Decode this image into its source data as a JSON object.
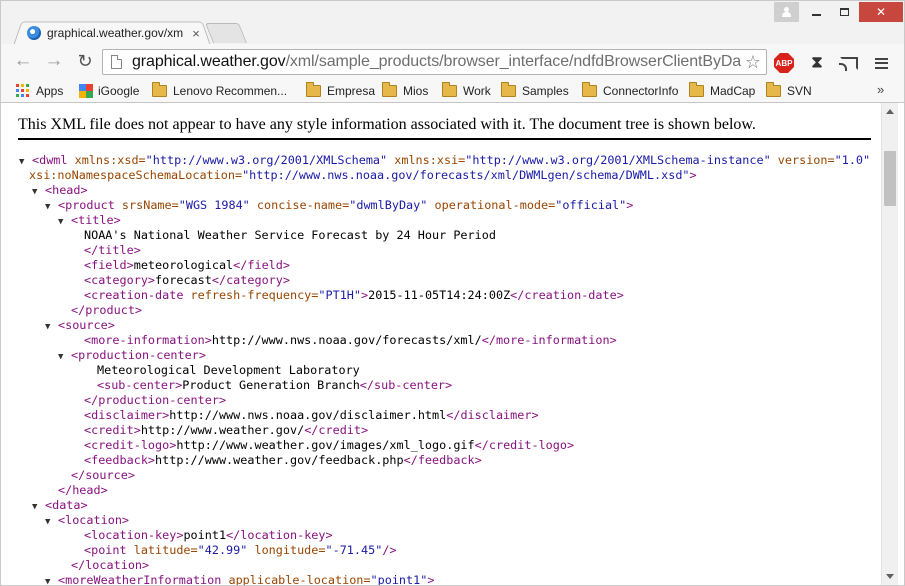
{
  "tab": {
    "title": "graphical.weather.gov/xm",
    "close": "×"
  },
  "window": {
    "minimize": "",
    "maximize": "",
    "close": "✕"
  },
  "nav": {
    "back": "←",
    "forward": "→",
    "reload": "↻",
    "star": "☆",
    "abp": "ABP"
  },
  "omnibox": {
    "host": "graphical.weather.gov",
    "path": "/xml/sample_products/browser_interface/ndfdBrowserClientByDa"
  },
  "bookmarks": {
    "items": [
      {
        "label": "Apps",
        "icon": "apps-icon"
      },
      {
        "label": "iGoogle",
        "icon": "igoogle-icon"
      },
      {
        "label": "Lenovo Recommen...",
        "icon": "folder-icon"
      },
      {
        "label": "Empresa",
        "icon": "folder-icon"
      },
      {
        "label": "Mios",
        "icon": "folder-icon"
      },
      {
        "label": "Work",
        "icon": "folder-icon"
      },
      {
        "label": "Samples",
        "icon": "folder-icon"
      },
      {
        "label": "ConnectorInfo",
        "icon": "folder-icon"
      },
      {
        "label": "MadCap",
        "icon": "folder-icon"
      },
      {
        "label": "SVN",
        "icon": "folder-icon"
      }
    ],
    "more": "»"
  },
  "page": {
    "info": "This XML file does not appear to have any style information associated with it. The document tree is shown below."
  },
  "xml_lines": [
    {
      "indent": 0,
      "tri": "▼",
      "parts": [
        [
          "t",
          "<dwml "
        ],
        [
          "n",
          "xmlns:xsd="
        ],
        [
          "v",
          "\"http://www.w3.org/2001/XMLSchema\""
        ],
        [
          "x",
          " "
        ],
        [
          "n",
          "xmlns:xsi="
        ],
        [
          "v",
          "\"http://www.w3.org/2001/XMLSchema-instance\""
        ],
        [
          "x",
          " "
        ],
        [
          "n",
          "version="
        ],
        [
          "v",
          "\"1.0\""
        ]
      ]
    },
    {
      "indent": 0,
      "tri": "",
      "parts": [
        [
          "n",
          "xsi:noNamespaceSchemaLocation="
        ],
        [
          "v",
          "\"http://www.nws.noaa.gov/forecasts/xml/DWMLgen/schema/DWML.xsd\""
        ],
        [
          "t",
          ">"
        ]
      ]
    },
    {
      "indent": 1,
      "tri": "▼",
      "parts": [
        [
          "t",
          "<head>"
        ]
      ]
    },
    {
      "indent": 2,
      "tri": "▼",
      "parts": [
        [
          "t",
          "<product "
        ],
        [
          "n",
          "srsName="
        ],
        [
          "v",
          "\"WGS 1984\""
        ],
        [
          "x",
          " "
        ],
        [
          "n",
          "concise-name="
        ],
        [
          "v",
          "\"dwmlByDay\""
        ],
        [
          "x",
          " "
        ],
        [
          "n",
          "operational-mode="
        ],
        [
          "v",
          "\"official\""
        ],
        [
          "t",
          ">"
        ]
      ]
    },
    {
      "indent": 3,
      "tri": "▼",
      "parts": [
        [
          "t",
          "<title>"
        ]
      ]
    },
    {
      "indent": 4,
      "tri": "",
      "parts": [
        [
          "x",
          "NOAA's National Weather Service Forecast by 24 Hour Period"
        ]
      ]
    },
    {
      "indent": 4,
      "tri": "",
      "parts": [
        [
          "t",
          "</title>"
        ]
      ]
    },
    {
      "indent": 4,
      "tri": "",
      "parts": [
        [
          "t",
          "<field>"
        ],
        [
          "x",
          "meteorological"
        ],
        [
          "t",
          "</field>"
        ]
      ]
    },
    {
      "indent": 4,
      "tri": "",
      "parts": [
        [
          "t",
          "<category>"
        ],
        [
          "x",
          "forecast"
        ],
        [
          "t",
          "</category>"
        ]
      ]
    },
    {
      "indent": 4,
      "tri": "",
      "parts": [
        [
          "t",
          "<creation-date "
        ],
        [
          "n",
          "refresh-frequency="
        ],
        [
          "v",
          "\"PT1H\""
        ],
        [
          "t",
          ">"
        ],
        [
          "x",
          "2015-11-05T14:24:00Z"
        ],
        [
          "t",
          "</creation-date>"
        ]
      ]
    },
    {
      "indent": 3,
      "tri": "",
      "parts": [
        [
          "t",
          "</product>"
        ]
      ]
    },
    {
      "indent": 2,
      "tri": "▼",
      "parts": [
        [
          "t",
          "<source>"
        ]
      ]
    },
    {
      "indent": 4,
      "tri": "",
      "parts": [
        [
          "t",
          "<more-information>"
        ],
        [
          "x",
          "http://www.nws.noaa.gov/forecasts/xml/"
        ],
        [
          "t",
          "</more-information>"
        ]
      ]
    },
    {
      "indent": 3,
      "tri": "▼",
      "parts": [
        [
          "t",
          "<production-center>"
        ]
      ]
    },
    {
      "indent": 5,
      "tri": "",
      "parts": [
        [
          "x",
          "Meteorological Development Laboratory"
        ]
      ]
    },
    {
      "indent": 5,
      "tri": "",
      "parts": [
        [
          "t",
          "<sub-center>"
        ],
        [
          "x",
          "Product Generation Branch"
        ],
        [
          "t",
          "</sub-center>"
        ]
      ]
    },
    {
      "indent": 4,
      "tri": "",
      "parts": [
        [
          "t",
          "</production-center>"
        ]
      ]
    },
    {
      "indent": 4,
      "tri": "",
      "parts": [
        [
          "t",
          "<disclaimer>"
        ],
        [
          "x",
          "http://www.nws.noaa.gov/disclaimer.html"
        ],
        [
          "t",
          "</disclaimer>"
        ]
      ]
    },
    {
      "indent": 4,
      "tri": "",
      "parts": [
        [
          "t",
          "<credit>"
        ],
        [
          "x",
          "http://www.weather.gov/"
        ],
        [
          "t",
          "</credit>"
        ]
      ]
    },
    {
      "indent": 4,
      "tri": "",
      "parts": [
        [
          "t",
          "<credit-logo>"
        ],
        [
          "x",
          "http://www.weather.gov/images/xml_logo.gif"
        ],
        [
          "t",
          "</credit-logo>"
        ]
      ]
    },
    {
      "indent": 4,
      "tri": "",
      "parts": [
        [
          "t",
          "<feedback>"
        ],
        [
          "x",
          "http://www.weather.gov/feedback.php"
        ],
        [
          "t",
          "</feedback>"
        ]
      ]
    },
    {
      "indent": 3,
      "tri": "",
      "parts": [
        [
          "t",
          "</source>"
        ]
      ]
    },
    {
      "indent": 2,
      "tri": "",
      "parts": [
        [
          "t",
          "</head>"
        ]
      ]
    },
    {
      "indent": 1,
      "tri": "▼",
      "parts": [
        [
          "t",
          "<data>"
        ]
      ]
    },
    {
      "indent": 2,
      "tri": "▼",
      "parts": [
        [
          "t",
          "<location>"
        ]
      ]
    },
    {
      "indent": 4,
      "tri": "",
      "parts": [
        [
          "t",
          "<location-key>"
        ],
        [
          "x",
          "point1"
        ],
        [
          "t",
          "</location-key>"
        ]
      ]
    },
    {
      "indent": 4,
      "tri": "",
      "parts": [
        [
          "t",
          "<point "
        ],
        [
          "n",
          "latitude="
        ],
        [
          "v",
          "\"42.99\""
        ],
        [
          "x",
          " "
        ],
        [
          "n",
          "longitude="
        ],
        [
          "v",
          "\"-71.45\""
        ],
        [
          "t",
          "/>"
        ]
      ]
    },
    {
      "indent": 3,
      "tri": "",
      "parts": [
        [
          "t",
          "</location>"
        ]
      ]
    },
    {
      "indent": 2,
      "tri": "▼",
      "parts": [
        [
          "t",
          "<moreWeatherInformation "
        ],
        [
          "n",
          "applicable-location="
        ],
        [
          "v",
          "\"point1\""
        ],
        [
          "t",
          ">"
        ]
      ]
    }
  ]
}
